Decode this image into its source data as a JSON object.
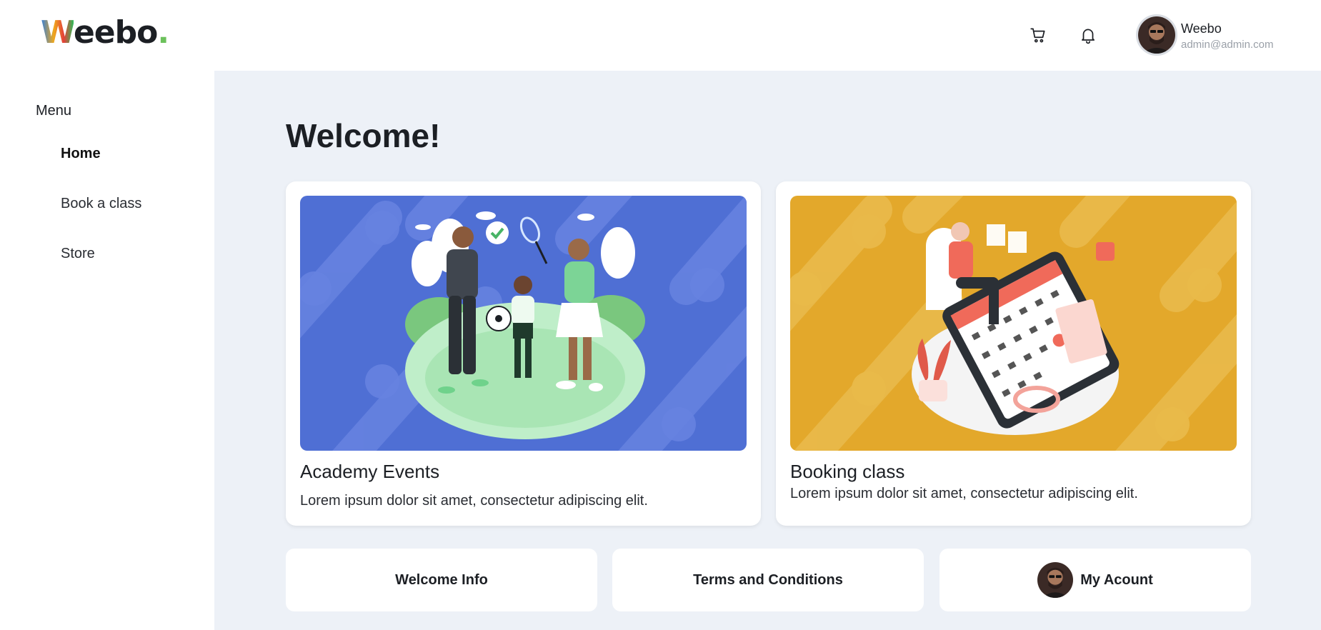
{
  "header": {
    "logo_text": "Weebo",
    "icons": [
      "cart-icon",
      "bell-icon"
    ],
    "user": {
      "name": "Weebo",
      "email": "admin@admin.com"
    }
  },
  "sidebar": {
    "title": "Menu",
    "items": [
      {
        "label": "Home",
        "active": true
      },
      {
        "label": "Book a class",
        "active": false
      },
      {
        "label": "Store",
        "active": false
      }
    ]
  },
  "main": {
    "heading": "Welcome!",
    "cards": [
      {
        "title": "Academy Events",
        "description": "Lorem ipsum dolor sit amet, consectetur adipiscing elit.",
        "image": "sports-family-illustration",
        "bg": "#4f6fd4"
      },
      {
        "title": "Booking class",
        "description": "Lorem ipsum dolor sit amet, consectetur adipiscing elit.",
        "image": "calendar-booking-illustration",
        "bg": "#e3a82b"
      }
    ],
    "tiles": [
      {
        "label": "Welcome Info"
      },
      {
        "label": "Terms and Conditions"
      },
      {
        "label": "My Acount"
      }
    ]
  },
  "colors": {
    "main_bg": "#edf1f7",
    "card_bg": "#ffffff",
    "text": "#1c1f24",
    "muted": "#9aa0a8"
  }
}
